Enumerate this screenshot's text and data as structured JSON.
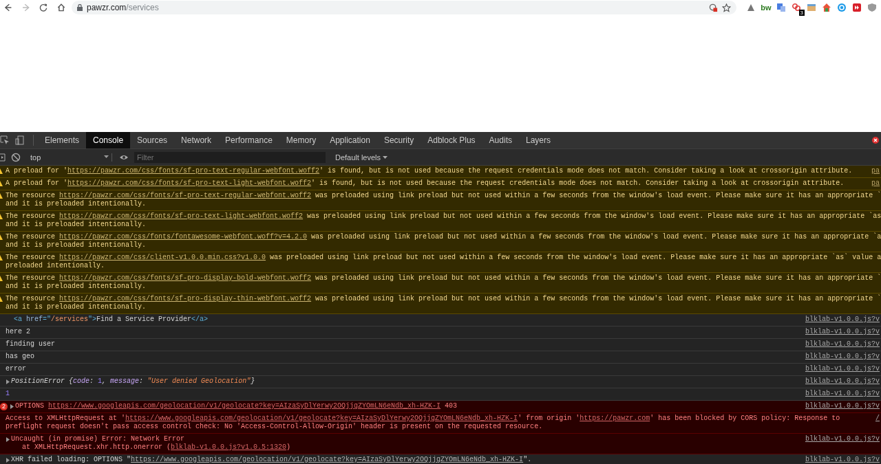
{
  "browser": {
    "nav": [
      {
        "kind": "back",
        "disabled": false
      },
      {
        "kind": "forward",
        "disabled": true
      },
      {
        "kind": "reload",
        "disabled": false
      },
      {
        "kind": "home",
        "disabled": false
      }
    ],
    "address": {
      "domain": "pawzr.com",
      "path": "/services"
    },
    "extensions": [
      {
        "kind": "triangle"
      },
      {
        "kind": "text",
        "text": "bw"
      },
      {
        "kind": "translate"
      },
      {
        "kind": "links",
        "badge": "3"
      },
      {
        "kind": "face"
      },
      {
        "kind": "house"
      },
      {
        "kind": "sync"
      },
      {
        "kind": "media"
      },
      {
        "kind": "shield"
      }
    ]
  },
  "devtools": {
    "tabs": [
      {
        "label": "Elements",
        "selected": false
      },
      {
        "label": "Console",
        "selected": true
      },
      {
        "label": "Sources",
        "selected": false
      },
      {
        "label": "Network",
        "selected": false
      },
      {
        "label": "Performance",
        "selected": false
      },
      {
        "label": "Memory",
        "selected": false
      },
      {
        "label": "Application",
        "selected": false
      },
      {
        "label": "Security",
        "selected": false
      },
      {
        "label": "Adblock Plus",
        "selected": false
      },
      {
        "label": "Audits",
        "selected": false
      },
      {
        "label": "Layers",
        "selected": false
      }
    ],
    "context": "top",
    "filter": {
      "placeholder": "Filter"
    },
    "levels": "Default levels"
  },
  "messages": [
    {
      "kind": "warning",
      "source": "pa",
      "lines": [
        [
          {
            "kind": "text",
            "text": "A preload for '"
          },
          {
            "kind": "link",
            "text": "https://pawzr.com/css/fonts/sf-pro-text-regular-webfont.woff2"
          },
          {
            "kind": "text",
            "text": "' is found, but is not used because the request credentials mode does not match. Consider taking a look at crossorigin attribute."
          }
        ]
      ]
    },
    {
      "kind": "warning",
      "source": "pa",
      "lines": [
        [
          {
            "kind": "text",
            "text": "A preload for '"
          },
          {
            "kind": "link",
            "text": "https://pawzr.com/css/fonts/sf-pro-text-light-webfont.woff2"
          },
          {
            "kind": "text",
            "text": "' is found, but is not used because the request credentials mode does not match. Consider taking a look at crossorigin attribute."
          }
        ]
      ]
    },
    {
      "kind": "warning",
      "lines": [
        [
          {
            "kind": "text",
            "text": "The resource "
          },
          {
            "kind": "link",
            "text": "https://pawzr.com/css/fonts/sf-pro-text-regular-webfont.woff2"
          },
          {
            "kind": "text",
            "text": " was preloaded using link preload but not used within a few seconds from the window's load event. Please make sure it has an appropriate `"
          }
        ],
        [
          {
            "kind": "text",
            "text": "and it is preloaded intentionally."
          }
        ]
      ]
    },
    {
      "kind": "warning",
      "lines": [
        [
          {
            "kind": "text",
            "text": "The resource "
          },
          {
            "kind": "link",
            "text": "https://pawzr.com/css/fonts/sf-pro-text-light-webfont.woff2"
          },
          {
            "kind": "text",
            "text": " was preloaded using link preload but not used within a few seconds from the window's load event. Please make sure it has an appropriate `as"
          }
        ],
        [
          {
            "kind": "text",
            "text": "and it is preloaded intentionally."
          }
        ]
      ]
    },
    {
      "kind": "warning",
      "lines": [
        [
          {
            "kind": "text",
            "text": "The resource "
          },
          {
            "kind": "link",
            "text": "https://pawzr.com/css/fonts/fontawesome-webfont.woff?v=4.2.0"
          },
          {
            "kind": "text",
            "text": " was preloaded using link preload but not used within a few seconds from the window's load event. Please make sure it has an appropriate `a"
          }
        ],
        [
          {
            "kind": "text",
            "text": "and it is preloaded intentionally."
          }
        ]
      ]
    },
    {
      "kind": "warning",
      "lines": [
        [
          {
            "kind": "text",
            "text": "The resource "
          },
          {
            "kind": "link",
            "text": "https://pawzr.com/css/client-v1.0.0.min.css?v1.0.0"
          },
          {
            "kind": "text",
            "text": " was preloaded using link preload but not used within a few seconds from the window's load event. Please make sure it has an appropriate `as` value a"
          }
        ],
        [
          {
            "kind": "text",
            "text": "preloaded intentionally."
          }
        ]
      ]
    },
    {
      "kind": "warning",
      "lines": [
        [
          {
            "kind": "text",
            "text": "The resource "
          },
          {
            "kind": "link",
            "text": "https://pawzr.com/css/fonts/sf-pro-display-bold-webfont.woff2"
          },
          {
            "kind": "text",
            "text": " was preloaded using link preload but not used within a few seconds from the window's load event. Please make sure it has an appropriate `"
          }
        ],
        [
          {
            "kind": "text",
            "text": "and it is preloaded intentionally."
          }
        ]
      ]
    },
    {
      "kind": "warning",
      "lines": [
        [
          {
            "kind": "text",
            "text": "The resource "
          },
          {
            "kind": "link",
            "text": "https://pawzr.com/css/fonts/sf-pro-display-thin-webfont.woff2"
          },
          {
            "kind": "text",
            "text": " was preloaded using link preload but not used within a few seconds from the window's load event. Please make sure it has an appropriate `"
          }
        ],
        [
          {
            "kind": "text",
            "text": "and it is preloaded intentionally."
          }
        ]
      ]
    },
    {
      "kind": "element",
      "source": "blklab-v1.0.0.js?v",
      "lines": [
        [
          {
            "kind": "tag",
            "text": "<a "
          },
          {
            "kind": "attr",
            "text": "href"
          },
          {
            "kind": "tag",
            "text": "=\""
          },
          {
            "kind": "attrvalue",
            "text": "/services"
          },
          {
            "kind": "tag",
            "text": "\">"
          },
          {
            "kind": "text",
            "text": "Find a Service Provider"
          },
          {
            "kind": "tag",
            "text": "</a>"
          }
        ]
      ]
    },
    {
      "kind": "log",
      "source": "blklab-v1.0.0.js?v",
      "lines": [
        [
          {
            "kind": "text",
            "text": "here 2"
          }
        ]
      ]
    },
    {
      "kind": "log",
      "source": "blklab-v1.0.0.js?v",
      "lines": [
        [
          {
            "kind": "text",
            "text": "finding user"
          }
        ]
      ]
    },
    {
      "kind": "log",
      "source": "blklab-v1.0.0.js?v",
      "lines": [
        [
          {
            "kind": "text",
            "text": "has geo"
          }
        ]
      ]
    },
    {
      "kind": "log",
      "source": "blklab-v1.0.0.js?v",
      "lines": [
        [
          {
            "kind": "text",
            "text": "error"
          }
        ]
      ]
    },
    {
      "kind": "log",
      "expandable": true,
      "source": "blklab-v1.0.0.js?v",
      "lines": [
        [
          {
            "kind": "italic",
            "text": "PositionError {"
          },
          {
            "kind": "key",
            "text": "code"
          },
          {
            "kind": "italic",
            "text": ": "
          },
          {
            "kind": "num",
            "text": "1"
          },
          {
            "kind": "italic",
            "text": ", "
          },
          {
            "kind": "key",
            "text": "message"
          },
          {
            "kind": "italic",
            "text": ": "
          },
          {
            "kind": "str",
            "text": "\"User denied Geolocation\""
          },
          {
            "kind": "italic",
            "text": "}"
          }
        ]
      ]
    },
    {
      "kind": "log",
      "source": "blklab-v1.0.0.js?v",
      "lines": [
        [
          {
            "kind": "num",
            "text": "1"
          }
        ]
      ]
    },
    {
      "kind": "error",
      "count": "2",
      "expandable": true,
      "source": "blklab-v1.0.0.js?v",
      "lines": [
        [
          {
            "kind": "text",
            "text": "OPTIONS "
          },
          {
            "kind": "link",
            "text": "https://www.googleapis.com/geolocation/v1/geolocate?key=AIzaSyDlYerwy2OQjjgZYOmLN6eNdb_xh-HZK-I"
          },
          {
            "kind": "text",
            "text": " 403"
          }
        ]
      ]
    },
    {
      "kind": "error",
      "source": "/",
      "lines": [
        [
          {
            "kind": "text",
            "text": "Access to XMLHttpRequest at '"
          },
          {
            "kind": "link",
            "text": "https://www.googleapis.com/geolocation/v1/geolocate?key=AIzaSyDlYerwy2OQjjgZYOmLN6eNdb_xh-HZK-I"
          },
          {
            "kind": "text",
            "text": "' from origin '"
          },
          {
            "kind": "link",
            "text": "https://pawzr.com"
          },
          {
            "kind": "text",
            "text": "' has been blocked by CORS policy: Response to"
          }
        ],
        [
          {
            "kind": "text",
            "text": "preflight request doesn't pass access control check: No 'Access-Control-Allow-Origin' header is present on the requested resource."
          }
        ]
      ]
    },
    {
      "kind": "error",
      "expandable": true,
      "source": "blklab-v1.0.0.js?v",
      "lines": [
        [
          {
            "kind": "text",
            "text": "Uncaught (in promise) Error: Network Error"
          }
        ],
        [
          {
            "kind": "text",
            "text": "    at XMLHttpRequest.xhr.http.onerror ("
          },
          {
            "kind": "link",
            "text": "blklab-v1.0.0.js?v1.0.5:1320"
          },
          {
            "kind": "text",
            "text": ")"
          }
        ]
      ]
    },
    {
      "kind": "log",
      "expandable": true,
      "source": "blklab-v1.0.0.js?v",
      "lines": [
        [
          {
            "kind": "text",
            "text": "XHR failed loading: OPTIONS \""
          },
          {
            "kind": "link",
            "text": "https://www.googleapis.com/geolocation/v1/geolocate?key=AIzaSyDlYerwy2OQjjgZYOmLN6eNdb_xh-HZK-I"
          },
          {
            "kind": "text",
            "text": "\"."
          }
        ]
      ]
    }
  ]
}
